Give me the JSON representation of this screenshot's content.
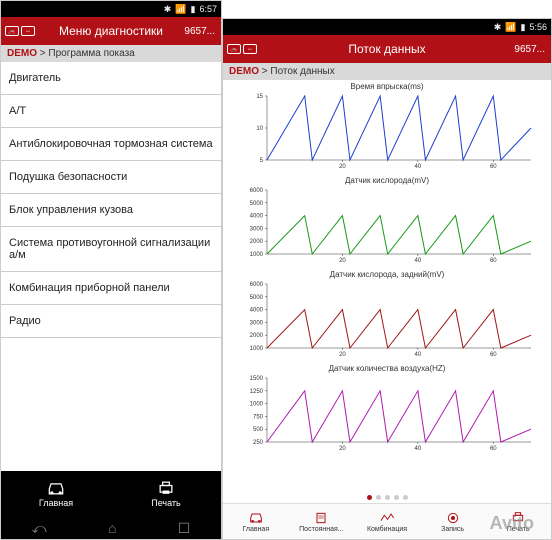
{
  "status": {
    "time_left": "6:57",
    "time_right": "5:56",
    "icons": [
      "bt-icon",
      "signal-icon",
      "battery-icon"
    ]
  },
  "left_screen": {
    "header_title": "Меню диагностики",
    "header_right": "9657...",
    "breadcrumb_demo": "DEMO",
    "breadcrumb_rest": " > Программа показа",
    "menu_items": [
      "Двигатель",
      "А/Т",
      "Антиблокировочная тормозная система",
      "Подушка безопасности",
      "Блок управления кузова",
      "Система противоугонной сигнализации а/м",
      "Комбинация приборной панели",
      "Радио"
    ],
    "nav": {
      "home": "Главная",
      "print": "Печать"
    }
  },
  "right_screen": {
    "header_title": "Поток данных",
    "header_right": "9657...",
    "breadcrumb_demo": "DEMO",
    "breadcrumb_rest": " > Поток данных",
    "nav_items": [
      "Главная",
      "Постоянная...",
      "Комбинация",
      "Запись",
      "Печать"
    ],
    "dots": {
      "count": 5,
      "active": 0
    }
  },
  "colors": {
    "accent": "#b11116",
    "chart1": "#1a3fd1",
    "chart2": "#1a9a1a",
    "chart3": "#a01515",
    "chart4": "#b01ab0"
  },
  "chart_data": [
    {
      "type": "line",
      "title": "Время впрыска(ms)",
      "xlabel": "",
      "ylabel": "",
      "x": [
        0,
        10,
        12,
        20,
        22,
        30,
        32,
        40,
        42,
        50,
        52,
        60,
        62,
        70
      ],
      "values": [
        5,
        15,
        5,
        15,
        5,
        15,
        5,
        15,
        5,
        15,
        5,
        15,
        5,
        10
      ],
      "color_key": "chart1",
      "ylim": [
        5,
        15
      ],
      "yticks": [
        5,
        10,
        15
      ],
      "xticks": [
        20,
        40,
        60
      ]
    },
    {
      "type": "line",
      "title": "Датчик кислорода(mV)",
      "xlabel": "",
      "ylabel": "",
      "x": [
        0,
        10,
        12,
        20,
        22,
        30,
        32,
        40,
        42,
        50,
        52,
        60,
        62,
        70
      ],
      "values": [
        1000,
        4000,
        1000,
        4000,
        1000,
        4000,
        1000,
        4000,
        1000,
        4000,
        1000,
        4000,
        1000,
        2000
      ],
      "color_key": "chart2",
      "ylim": [
        1000,
        6000
      ],
      "yticks": [
        1000,
        2000,
        3000,
        4000,
        5000,
        6000
      ],
      "xticks": [
        20,
        40,
        60
      ]
    },
    {
      "type": "line",
      "title": "Датчик кислорода, задний(mV)",
      "xlabel": "",
      "ylabel": "",
      "x": [
        0,
        10,
        12,
        20,
        22,
        30,
        32,
        40,
        42,
        50,
        52,
        60,
        62,
        70
      ],
      "values": [
        1000,
        4000,
        1000,
        4000,
        1000,
        4000,
        1000,
        4000,
        1000,
        4000,
        1000,
        4000,
        1000,
        2000
      ],
      "color_key": "chart3",
      "ylim": [
        1000,
        6000
      ],
      "yticks": [
        1000,
        2000,
        3000,
        4000,
        5000,
        6000
      ],
      "xticks": [
        20,
        40,
        60
      ]
    },
    {
      "type": "line",
      "title": "Датчик количества воздуха(HZ)",
      "xlabel": "",
      "ylabel": "",
      "x": [
        0,
        10,
        12,
        20,
        22,
        30,
        32,
        40,
        42,
        50,
        52,
        60,
        62,
        70
      ],
      "values": [
        250,
        1250,
        250,
        1250,
        250,
        1250,
        250,
        1250,
        250,
        1250,
        250,
        1250,
        250,
        500
      ],
      "color_key": "chart4",
      "ylim": [
        250,
        1500
      ],
      "yticks": [
        250,
        500,
        750,
        1000,
        1250,
        1500
      ],
      "xticks": [
        20,
        40,
        60
      ]
    }
  ],
  "watermark": "Avito"
}
